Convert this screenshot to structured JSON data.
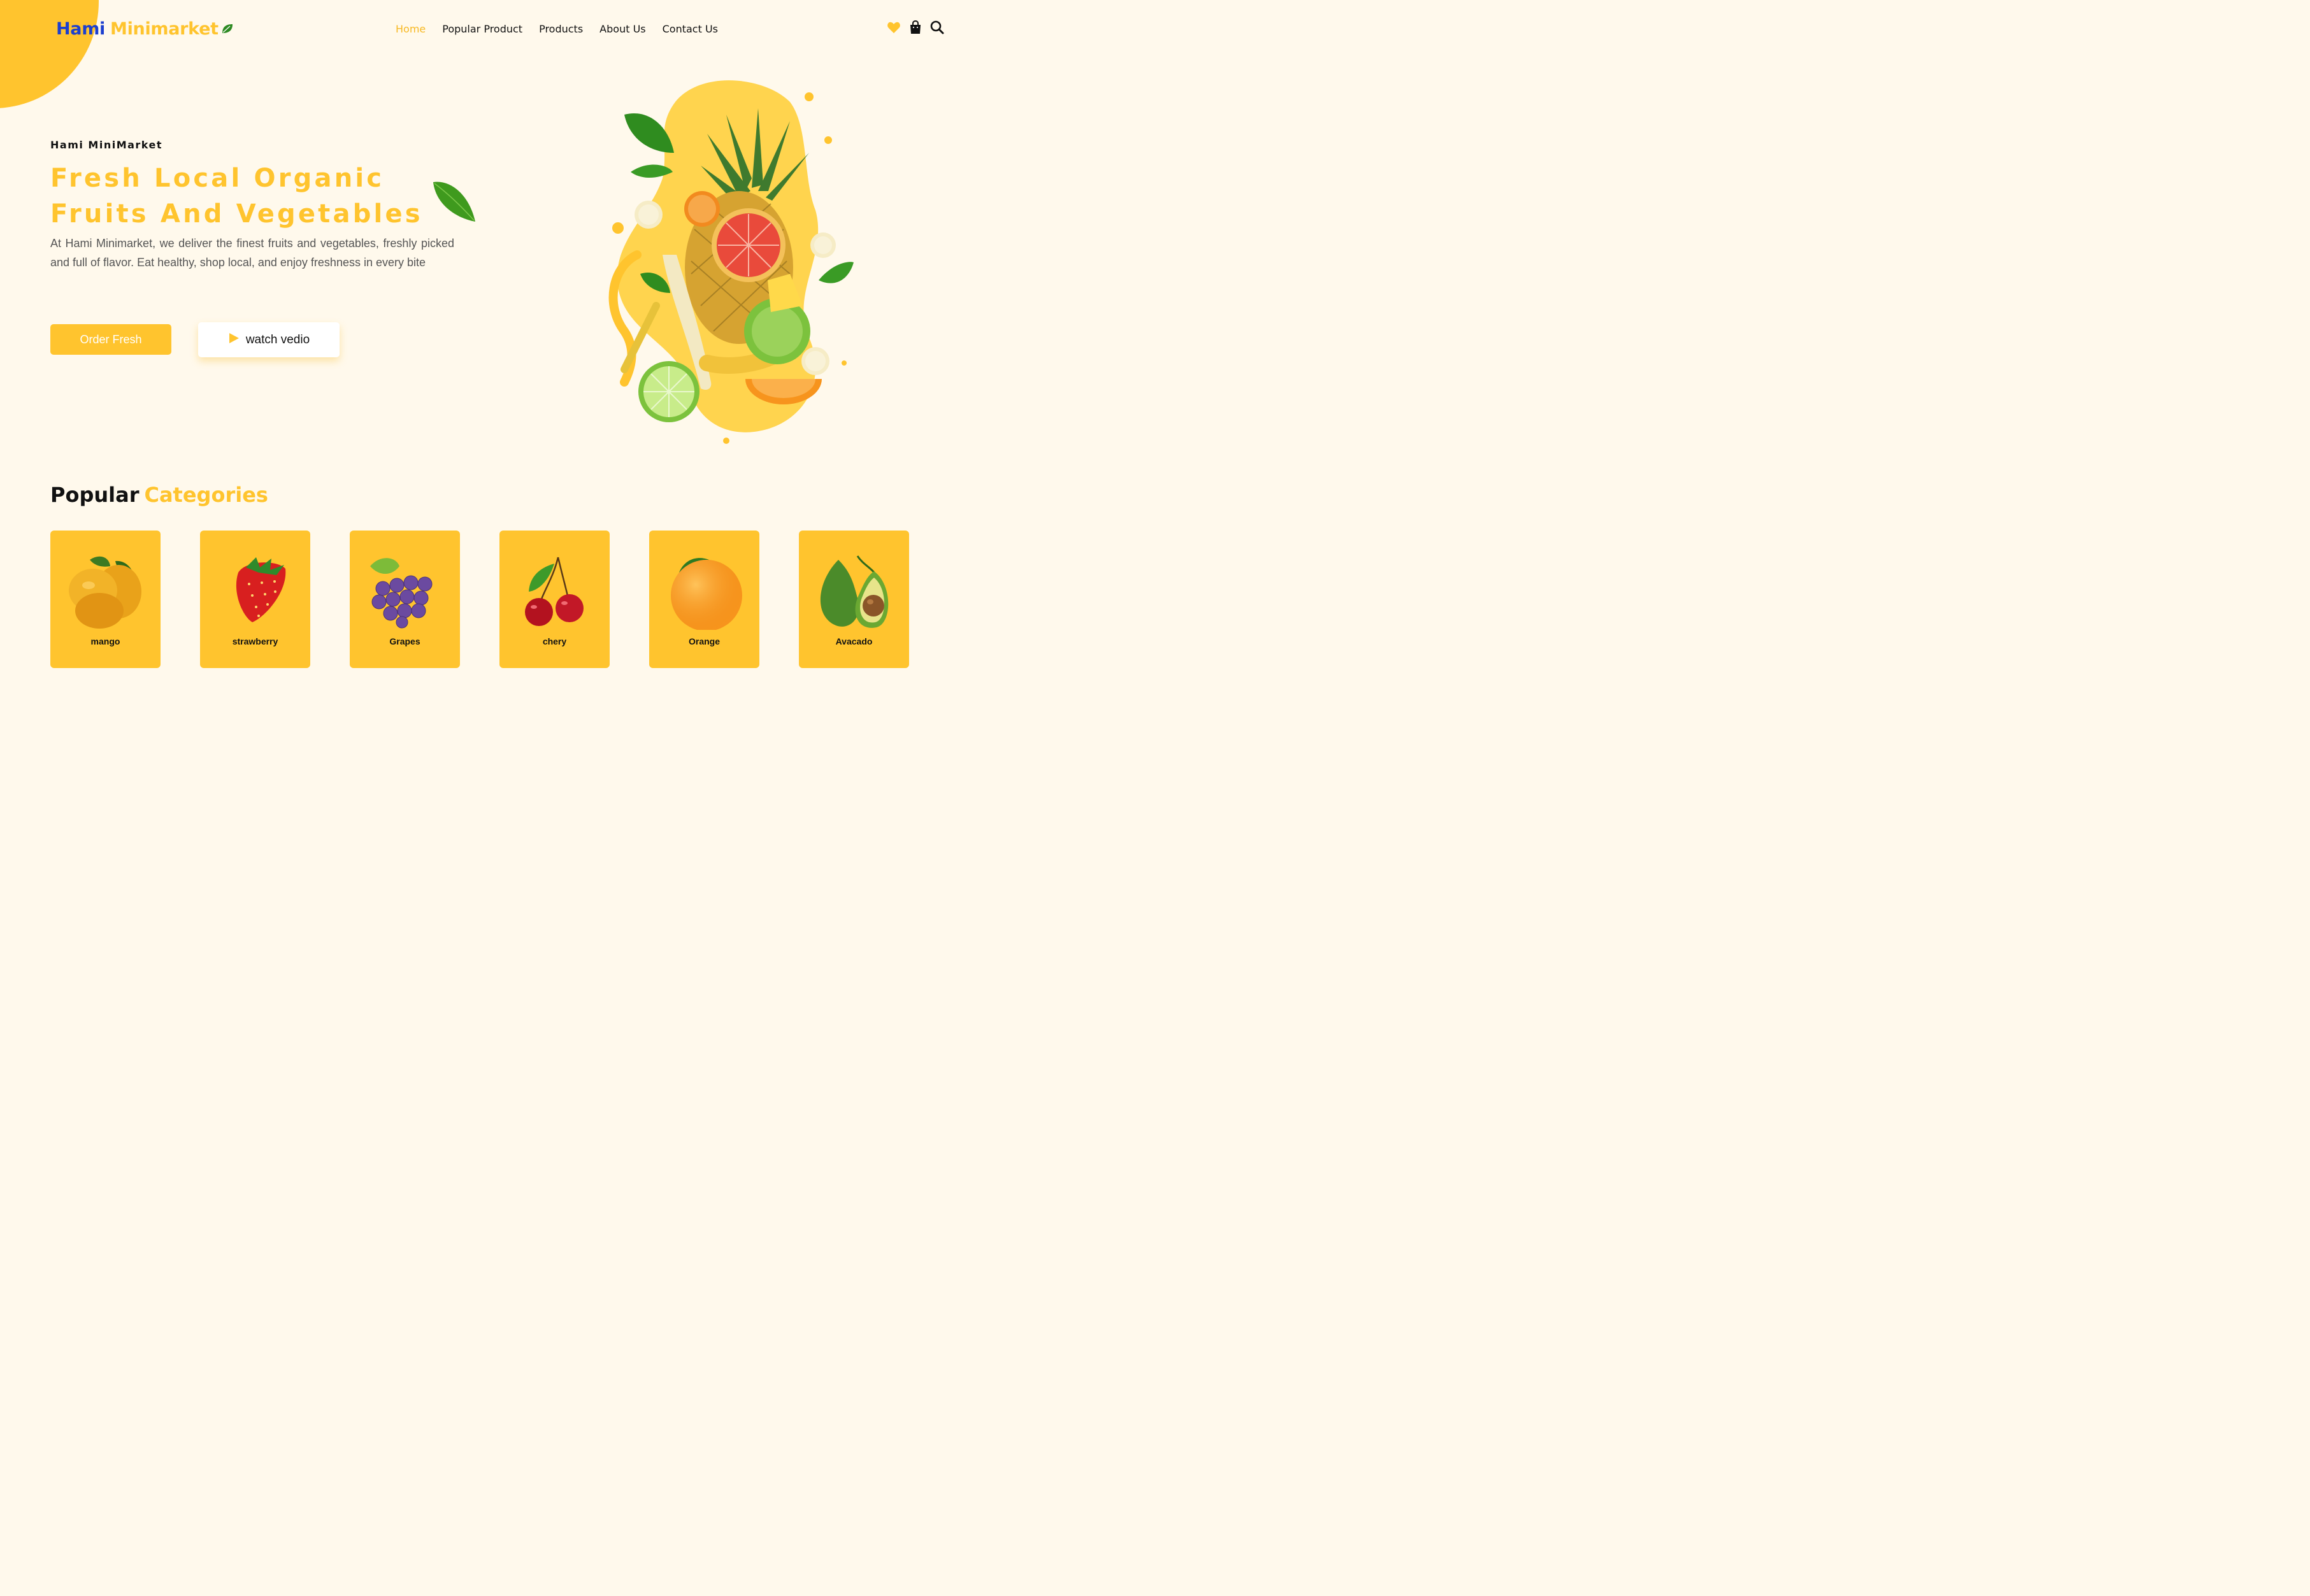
{
  "brand": {
    "name_part1": "Hami",
    "name_part2": "Minimarket"
  },
  "nav": {
    "items": [
      {
        "label": "Home",
        "active": true
      },
      {
        "label": "Popular Product"
      },
      {
        "label": "Products"
      },
      {
        "label": "About Us"
      },
      {
        "label": "Contact Us"
      }
    ]
  },
  "header_icons": [
    "heart-icon",
    "shopping-bag-icon",
    "search-icon"
  ],
  "hero": {
    "subtitle": "Hami MiniMarket",
    "title": "Fresh Local Organic Fruits And Vegetables",
    "description": "At Hami Minimarket, we deliver the finest fruits and vegetables, freshly picked and full of flavor. Eat healthy, shop local, and enjoy freshness in every bite",
    "primary_button": "Order Fresh",
    "secondary_button": "watch vedio"
  },
  "categories": {
    "title_part1": "Popular",
    "title_part2": "Categories",
    "items": [
      {
        "name": "mango",
        "icon": "mango-icon"
      },
      {
        "name": "strawberry",
        "icon": "strawberry-icon"
      },
      {
        "name": "Grapes",
        "icon": "grapes-icon"
      },
      {
        "name": "chery",
        "icon": "cherry-icon"
      },
      {
        "name": "Orange",
        "icon": "orange-icon"
      },
      {
        "name": "Avacado",
        "icon": "avocado-icon"
      }
    ]
  },
  "colors": {
    "accent": "#ffc42e",
    "background": "#fff9ec",
    "brand_blue": "#1c3fcf",
    "active_nav": "#f7b924"
  }
}
